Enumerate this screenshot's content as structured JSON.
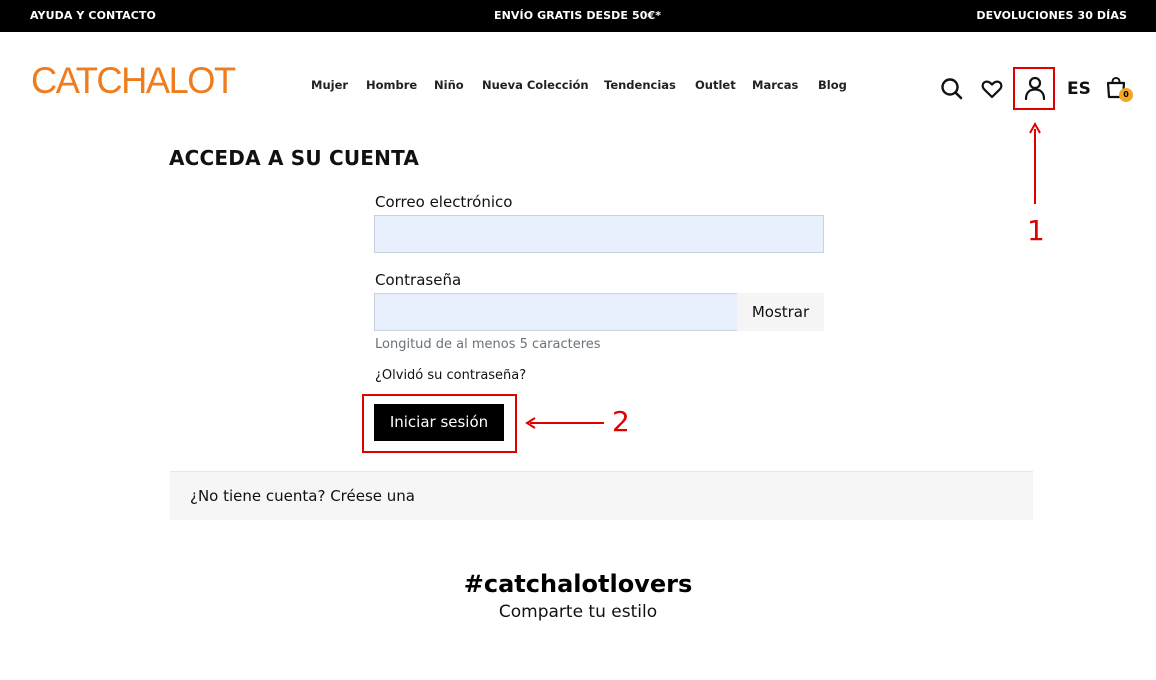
{
  "topbar": {
    "help": "AYUDA Y CONTACTO",
    "shipping": "ENVÍO GRATIS DESDE 50€*",
    "returns": "DEVOLUCIONES 30 DÍAS"
  },
  "brand": {
    "logo": "CATCHALOT",
    "color": "#ef7d1d"
  },
  "nav": {
    "items": [
      {
        "label": "Mujer"
      },
      {
        "label": "Hombre"
      },
      {
        "label": "Niño"
      },
      {
        "label": "Nueva Colección"
      },
      {
        "label": "Tendencias"
      },
      {
        "label": "Outlet"
      },
      {
        "label": "Marcas"
      },
      {
        "label": "Blog"
      }
    ]
  },
  "header_icons": {
    "search": "search-icon",
    "wishlist": "heart-icon",
    "account": "user-icon",
    "language": "ES",
    "cart": "shopping-bag-icon",
    "cart_count": "0"
  },
  "login": {
    "title": "ACCEDA A SU CUENTA",
    "email_label": "Correo electrónico",
    "email_value": "",
    "password_label": "Contraseña",
    "password_value": "",
    "show_label": "Mostrar",
    "password_hint": "Longitud de al menos 5 caracteres",
    "forgot": "¿Olvidó su contraseña?",
    "submit": "Iniciar sesión",
    "register": "¿No tiene cuenta? Créese una"
  },
  "footer_promo": {
    "title": "#catchalotlovers",
    "subtitle": "Comparte tu estilo"
  },
  "annotations": {
    "step1": "1",
    "step2": "2",
    "color": "#e00000"
  }
}
